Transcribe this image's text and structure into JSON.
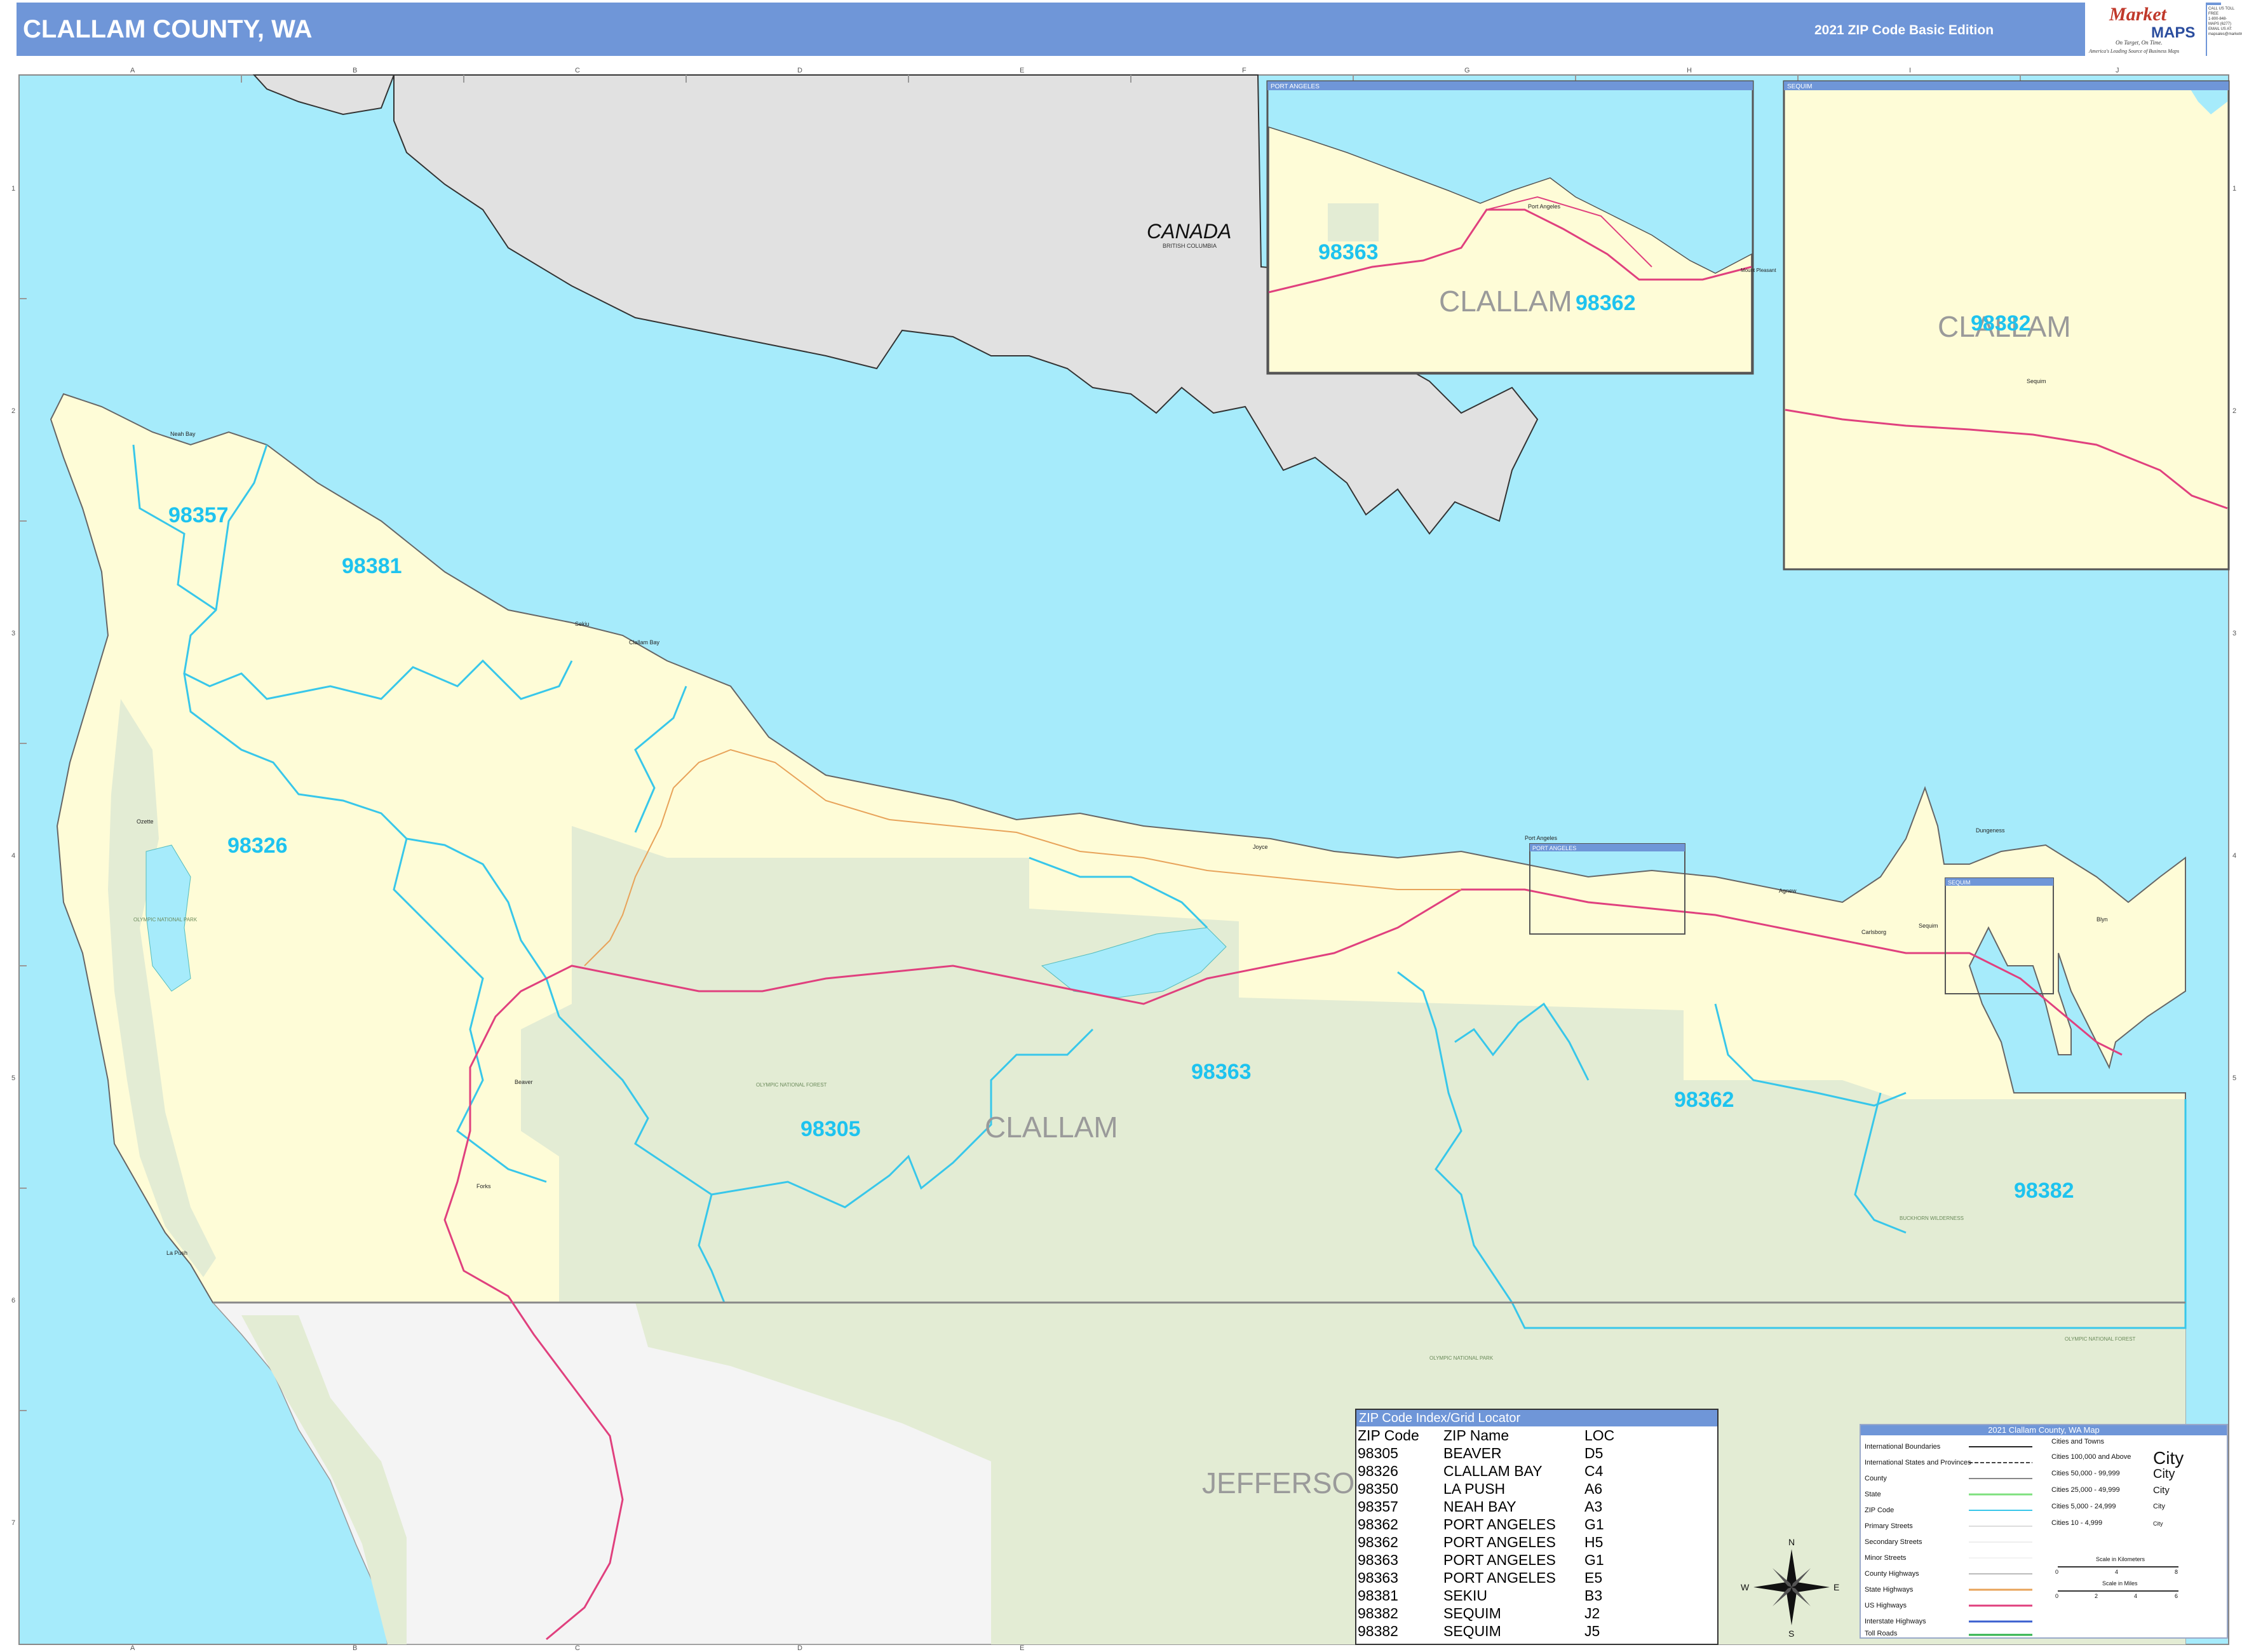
{
  "header": {
    "title": "CLALLAM COUNTY, WA",
    "edition": "2021 ZIP Code Basic Edition",
    "logo_text_1": "Market",
    "logo_text_2": "MAPS",
    "logo_tagline": "On Target, On Time.",
    "logo_subline": "America's Leading Source of Business Maps",
    "contact_lines": [
      "CALL US TOLL FREE",
      "1-800-848-MAPS (6277)",
      "EMAIL US AT:",
      "mapsales@marketmaps.com"
    ]
  },
  "colors": {
    "water": "#a6ebfb",
    "county_fill": "#fefcd7",
    "forest_fill": "#e3ecd4",
    "canada_fill": "#e1e1e1",
    "outside_fill": "#f4f4f4",
    "zip_label": "#1ec3ef",
    "zip_boundary": "#38c7ea",
    "us_highway": "#e0407e",
    "state_highway": "#e8a35a",
    "header_blue": "#6f96d8"
  },
  "grid": {
    "columns": [
      "A",
      "B",
      "C",
      "D",
      "E",
      "F",
      "G",
      "H",
      "I",
      "J"
    ],
    "rows": [
      "1",
      "2",
      "3",
      "4",
      "5",
      "6",
      "7"
    ]
  },
  "map_labels": {
    "country": "CANADA",
    "province": "BRITISH COLUMBIA",
    "county": "CLALLAM",
    "neighbor_county": "JEFFERSON",
    "national_park": "OLYMPIC NATIONAL PARK",
    "national_forest": "OLYMPIC NATIONAL FOREST",
    "wilderness": "BUCKHORN WILDERNESS"
  },
  "zip_labels": [
    "98357",
    "98381",
    "98326",
    "98305",
    "98363",
    "98362",
    "98382"
  ],
  "towns": [
    "Neah Bay",
    "Sekiu",
    "Clallam Bay",
    "Ozette",
    "La Push",
    "Forks",
    "Beaver",
    "Joyce",
    "Port Angeles",
    "Sequim",
    "Carlsborg",
    "Dungeness",
    "Blyn",
    "Agnew"
  ],
  "insets": [
    {
      "title": "PORT ANGELES",
      "zips": [
        "98363",
        "98362"
      ],
      "county": "CLALLAM",
      "places": [
        "Port Angeles",
        "Mount Pleasant"
      ]
    },
    {
      "title": "SEQUIM",
      "zips": [
        "98382"
      ],
      "county": "CLALLAM",
      "places": [
        "Sequim"
      ]
    }
  ],
  "inset_markers": [
    "PORT ANGELES",
    "SEQUIM"
  ],
  "index": {
    "title": "ZIP Code Index/Grid Locator",
    "headers": [
      "ZIP Code",
      "ZIP Name",
      "LOC"
    ],
    "rows": [
      [
        "98305",
        "BEAVER",
        "D5"
      ],
      [
        "98326",
        "CLALLAM BAY",
        "C4"
      ],
      [
        "98350",
        "LA PUSH",
        "A6"
      ],
      [
        "98357",
        "NEAH BAY",
        "A3"
      ],
      [
        "98362",
        "PORT ANGELES",
        "G1"
      ],
      [
        "98362",
        "PORT ANGELES",
        "H5"
      ],
      [
        "98363",
        "PORT ANGELES",
        "G1"
      ],
      [
        "98363",
        "PORT ANGELES",
        "E5"
      ],
      [
        "98381",
        "SEKIU",
        "B3"
      ],
      [
        "98382",
        "SEQUIM",
        "J2"
      ],
      [
        "98382",
        "SEQUIM",
        "J5"
      ]
    ]
  },
  "legend": {
    "title": "2021 Clallam County, WA Map",
    "line_items": [
      "International Boundaries",
      "International States and Provinces",
      "County",
      "State",
      "ZIP Code",
      "Primary Streets",
      "Secondary Streets",
      "Minor Streets",
      "County Highways",
      "State Highways",
      "US Highways",
      "Interstate Highways",
      "Toll Roads"
    ],
    "city_items": [
      {
        "range": "Cities and Towns",
        "sample": ""
      },
      {
        "range": "Cities 100,000 and Above",
        "sample": "City"
      },
      {
        "range": "Cities 50,000 - 99,999",
        "sample": "City"
      },
      {
        "range": "Cities 25,000 - 49,999",
        "sample": "City"
      },
      {
        "range": "Cities 5,000 - 24,999",
        "sample": "City"
      },
      {
        "range": "Cities 10 - 4,999",
        "sample": "City"
      }
    ],
    "scale_km": "Scale in Kilometers",
    "scale_mi": "Scale in Miles",
    "scale_km_ticks": [
      "0",
      "4",
      "8"
    ],
    "scale_mi_ticks": [
      "0",
      "2",
      "4",
      "6"
    ]
  },
  "compass": {
    "n": "N",
    "s": "S",
    "e": "E",
    "w": "W"
  }
}
